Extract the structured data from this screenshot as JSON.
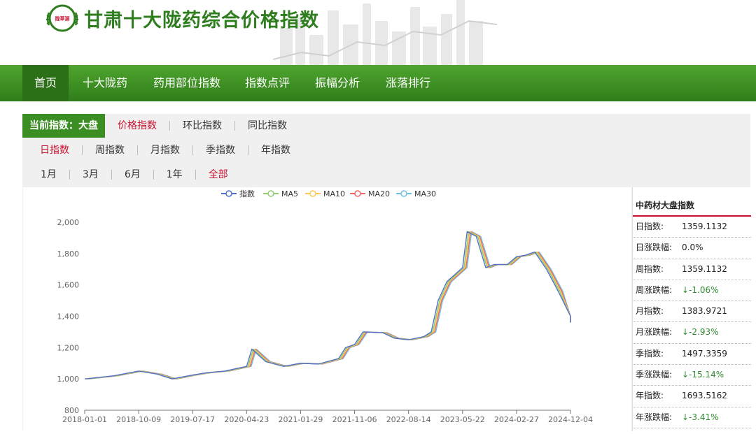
{
  "header": {
    "title": "甘肃十大陇药综合价格指数",
    "logo_text": "陇草源"
  },
  "nav": [
    "首页",
    "十大陇药",
    "药用部位指数",
    "指数点评",
    "振幅分析",
    "涨落排行"
  ],
  "current_index": {
    "label": "当前指数：大盘"
  },
  "type_options": [
    "价格指数",
    "环比指数",
    "同比指数"
  ],
  "period_options": [
    "日指数",
    "周指数",
    "月指数",
    "季指数",
    "年指数"
  ],
  "range_options": [
    "1月",
    "3月",
    "6月",
    "1年",
    "全部"
  ],
  "side_panel": {
    "title": "中药材大盘指数",
    "rows": [
      {
        "label": "日指数:",
        "value": "1359.1132",
        "trend": ""
      },
      {
        "label": "日涨跌幅:",
        "value": "0.0%",
        "trend": ""
      },
      {
        "label": "周指数:",
        "value": "1359.1132",
        "trend": ""
      },
      {
        "label": "周涨跌幅:",
        "value": "↓-1.06%",
        "trend": "down"
      },
      {
        "label": "月指数:",
        "value": "1383.9721",
        "trend": ""
      },
      {
        "label": "月涨跌幅:",
        "value": "↓-2.93%",
        "trend": "down"
      },
      {
        "label": "季指数:",
        "value": "1497.3359",
        "trend": ""
      },
      {
        "label": "季涨跌幅:",
        "value": "↓-15.14%",
        "trend": "down"
      },
      {
        "label": "年指数:",
        "value": "1693.5162",
        "trend": ""
      },
      {
        "label": "年涨跌幅:",
        "value": "↓-3.41%",
        "trend": "down"
      }
    ]
  },
  "colors": {
    "green": "#3b8e22",
    "red": "#c8102e",
    "index": "#5470c6",
    "ma5": "#91cc75",
    "ma10": "#fac858",
    "ma20": "#ee6666",
    "ma30": "#73c0de"
  },
  "chart_data": {
    "type": "line",
    "ylim": [
      800,
      2000
    ],
    "y_ticks": [
      "800",
      "1,000",
      "1,200",
      "1,400",
      "1,600",
      "1,800",
      "2,000"
    ],
    "x_ticks": [
      "2018-01-01",
      "2018-10-09",
      "2019-07-17",
      "2020-04-23",
      "2021-01-29",
      "2021-11-06",
      "2022-08-14",
      "2023-05-22",
      "2024-02-27",
      "2024-12-04"
    ],
    "legend": [
      "指数",
      "MA5",
      "MA10",
      "MA20",
      "MA30"
    ],
    "legend_position": "top",
    "series_colors": [
      "#5470c6",
      "#91cc75",
      "#fac858",
      "#ee6666",
      "#73c0de"
    ],
    "x": [
      "2018-01-01",
      "2018-06-01",
      "2018-10-09",
      "2019-01-15",
      "2019-04-01",
      "2019-07-17",
      "2019-10-01",
      "2020-01-01",
      "2020-04-23",
      "2020-05-20",
      "2020-08-01",
      "2020-11-01",
      "2021-01-29",
      "2021-05-01",
      "2021-08-15",
      "2021-09-20",
      "2021-11-06",
      "2021-12-20",
      "2022-04-01",
      "2022-06-01",
      "2022-08-14",
      "2022-11-01",
      "2022-12-10",
      "2023-01-15",
      "2023-03-01",
      "2023-05-22",
      "2023-06-15",
      "2023-08-01",
      "2023-09-20",
      "2023-11-01",
      "2024-01-10",
      "2024-02-27",
      "2024-04-15",
      "2024-06-01",
      "2024-08-01",
      "2024-10-01",
      "2024-12-04",
      "2025-01-10"
    ],
    "index_values": [
      1000,
      1020,
      1050,
      1030,
      1000,
      1025,
      1040,
      1050,
      1080,
      1190,
      1110,
      1080,
      1100,
      1095,
      1130,
      1200,
      1220,
      1300,
      1295,
      1260,
      1250,
      1270,
      1300,
      1500,
      1620,
      1710,
      1940,
      1910,
      1710,
      1730,
      1730,
      1780,
      1790,
      1810,
      1700,
      1560,
      1400,
      1360
    ]
  }
}
